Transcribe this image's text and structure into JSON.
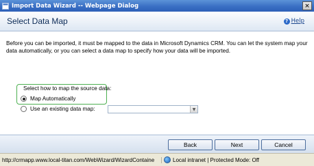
{
  "window": {
    "title": "Import Data Wizard -- Webpage Dialog",
    "close_label": "×"
  },
  "header": {
    "title": "Select Data Map",
    "help_label": "Help"
  },
  "content": {
    "intro": "Before you can be imported, it must be mapped to the data in Microsoft Dynamics CRM. You can let the system map your data automatically, or you can select a data map to specify how your data will be imported.",
    "map_prompt": "Select how to map the source data:",
    "options": [
      {
        "label": "Map Automatically",
        "selected": true
      },
      {
        "label": "Use an existing data map:",
        "selected": false
      }
    ],
    "data_map_select_value": ""
  },
  "buttons": {
    "back": "Back",
    "next": "Next",
    "cancel": "Cancel"
  },
  "status": {
    "url": "http://crmapp.www.local-titan.com/WebWizard/WizardContaine",
    "zone": "Local intranet | Protected Mode: Off"
  },
  "colors": {
    "titlebar": "#3a6fc4",
    "highlight": "#4caf50",
    "heading": "#0c2b57"
  }
}
